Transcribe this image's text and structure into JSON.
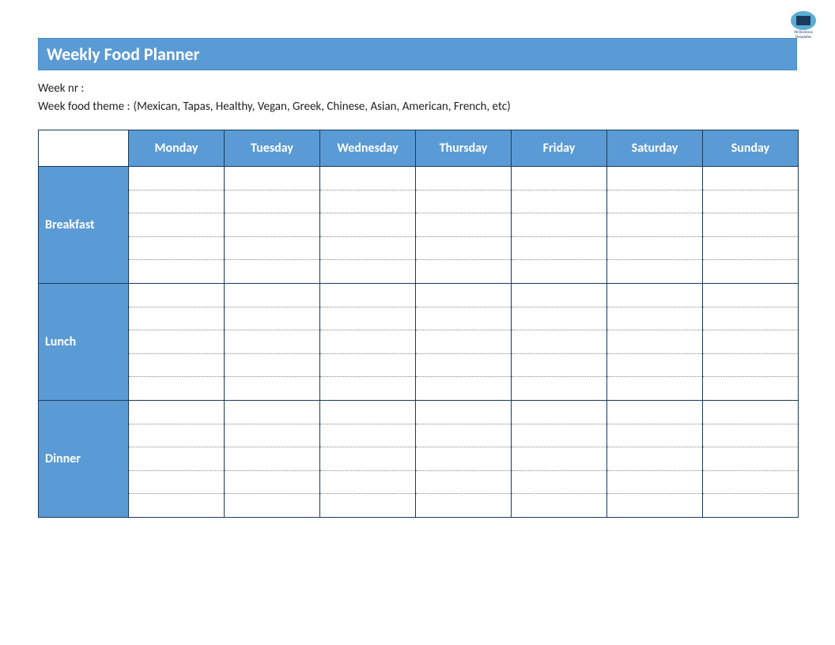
{
  "logo": {
    "line1": "All Business",
    "line2": "Templates"
  },
  "title": "Weekly Food Planner",
  "meta": {
    "week_nr_label": "Week nr :",
    "week_nr_value": "",
    "theme_label": "Week food theme :",
    "theme_value": "(Mexican, Tapas, Healthy, Vegan, Greek, Chinese, Asian, American, French, etc)"
  },
  "days": [
    "Monday",
    "Tuesday",
    "Wednesday",
    "Thursday",
    "Friday",
    "Saturday",
    "Sunday"
  ],
  "meals": [
    "Breakfast",
    "Lunch",
    "Dinner"
  ],
  "chart_data": {
    "type": "table",
    "columns": [
      "Monday",
      "Tuesday",
      "Wednesday",
      "Thursday",
      "Friday",
      "Saturday",
      "Sunday"
    ],
    "rows": [
      "Breakfast",
      "Lunch",
      "Dinner"
    ],
    "values": [
      [
        "",
        "",
        "",
        "",
        "",
        "",
        ""
      ],
      [
        "",
        "",
        "",
        "",
        "",
        "",
        ""
      ],
      [
        "",
        "",
        "",
        "",
        "",
        "",
        ""
      ]
    ]
  }
}
